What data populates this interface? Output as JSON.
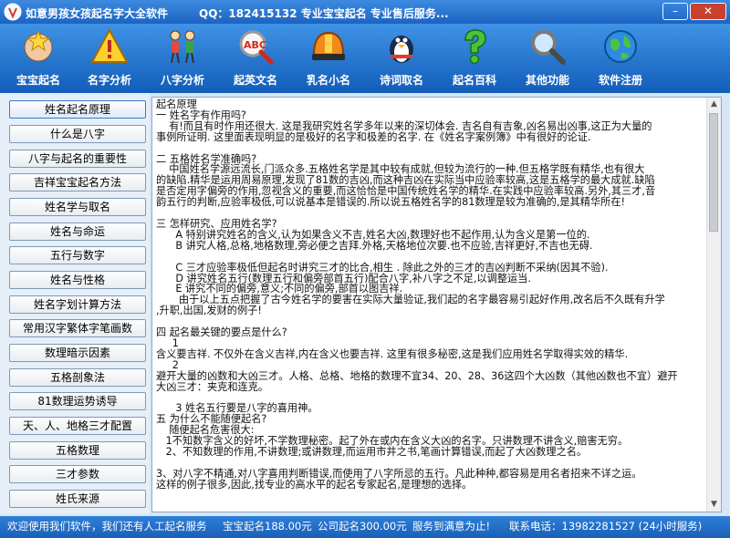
{
  "window": {
    "title": "如意男孩女孩起名字大全软件",
    "info": "QQ：182415132  专业宝宝起名  专业售后服务...",
    "minimize_glyph": "–",
    "close_glyph": "✕"
  },
  "toolbar": {
    "items": [
      {
        "label": "宝宝起名",
        "icon": "baby-star-icon"
      },
      {
        "label": "名字分析",
        "icon": "warning-triangle-icon"
      },
      {
        "label": "八字分析",
        "icon": "stick-figures-icon"
      },
      {
        "label": "起英文名",
        "icon": "abc-magnifier-icon"
      },
      {
        "label": "乳名小名",
        "icon": "helmet-icon"
      },
      {
        "label": "诗词取名",
        "icon": "penguin-icon"
      },
      {
        "label": "起名百科",
        "icon": "question-mark-icon"
      },
      {
        "label": "其他功能",
        "icon": "magnifier-icon"
      },
      {
        "label": "软件注册",
        "icon": "globe-icon"
      }
    ]
  },
  "sidebar": {
    "items": [
      {
        "label": "姓名起名原理"
      },
      {
        "label": "什么是八字"
      },
      {
        "label": "八字与起名的重要性"
      },
      {
        "label": "吉祥宝宝起名方法"
      },
      {
        "label": "姓名学与取名"
      },
      {
        "label": "姓名与命运"
      },
      {
        "label": "五行与数字"
      },
      {
        "label": "姓名与性格"
      },
      {
        "label": "姓名字划计算方法"
      },
      {
        "label": "常用汉字繁体字笔画数"
      },
      {
        "label": "数理暗示因素"
      },
      {
        "label": "五格剖象法"
      },
      {
        "label": "81数理运势诱导"
      },
      {
        "label": "天、人、地格三才配置"
      },
      {
        "label": "五格数理"
      },
      {
        "label": "三才参数"
      },
      {
        "label": "姓氏来源"
      }
    ]
  },
  "content": {
    "text": "起名原理\n一 姓名字有作用吗?\n    有!而且有时作用还很大. 这是我研究姓名学多年以来的深切体会. 吉名自有吉象,凶名易出凶事,这正为大量的\n事例所证明. 这里面表现明显的是极好的名字和极差的名字. 在《姓名字案例簿》中有很好的论证.\n\n二 五格姓名学准确吗?\n    中国姓名学源远流长,门派众多.五格姓名学是其中较有成就,但较为流行的一种.但五格学既有精华,也有很大\n的缺陷.精华是运用周易原理,发现了81数的吉凶,而这种吉凶在实际当中应验率较高,这是五格学的最大成就.缺陷\n是否定用字偏旁的作用,忽视含义的重要,而这恰恰是中国传统姓名学的精华.在实践中应验率较高.另外,其三才,音\n韵五行的判断,应验率极低,可以说基本是错误的.所以说五格姓名学的81数理是较为准确的,是其精华所在!\n\n三 怎样研究、应用姓名学?\n      A 特别讲究姓名的含义,认为如果含义不吉,姓名大凶,数理好也不起作用,认为含义是第一位的.\n      B 讲究人格,总格,地格数理,旁必便之吉拜.外格,天格地位次要.也不应验,吉祥更好,不吉也无碍.\n\n      C 三才应验率极低但起名时讲究三才的比合,相生 . 除此之外的三才的吉凶判断不采纳(因其不验).\n      D 讲究姓名五行(数理五行和偏旁部首五行)配合八字,补八字之不足,以调整运当.\n      E 讲究不同的偏旁,意义;不同的偏旁,部首以图吉祥.\n       由于以上五点把握了古今姓名学的要害在实际大量验证,我们起的名字最容易引起好作用,改名后不久既有升学\n,升职,出国,发财的例子!\n\n四 起名最关键的要点是什么?\n     1\n含义要吉祥. 不仅外在含义吉祥,内在含义也要吉祥. 这里有很多秘密,这是我们应用姓名学取得实效的精华.\n     2\n避开大量的凶数和大凶三才。人格、总格、地格的数理不宜34、20、28、36这四个大凶数（其他凶数也不宜）避开\n大凶三才：夹克和连克。\n\n      3 姓名五行要是八字的喜用神。\n五 为什么不能随便起名?\n    随便起名危害很大:\n   1不知数字含义的好坏,不学数理秘密。起了外在或内在含义大凶的名字。只讲数理不讲含义,赔害无穷。\n   2、不知数理的作用,不讲数理;或讲数理,而运用市井之书,笔画计算错误,而起了大凶数理之名。\n\n3、对八字不精通,对八字喜用判断错误,而使用了八字所忌的五行。凡此种种,都容易是用名者招来不详之运。\n这样的例子很多,因此,找专业的高水平的起名专家起名,是理想的选择。"
  },
  "status": {
    "welcome": "欢迎使用我们软件，我们还有人工起名服务",
    "baby_price": "宝宝起名188.00元",
    "company_price": "公司起名300.00元",
    "service": "服务到满意为止!",
    "phone": "联系电话：13982281527 (24小时服务)"
  }
}
